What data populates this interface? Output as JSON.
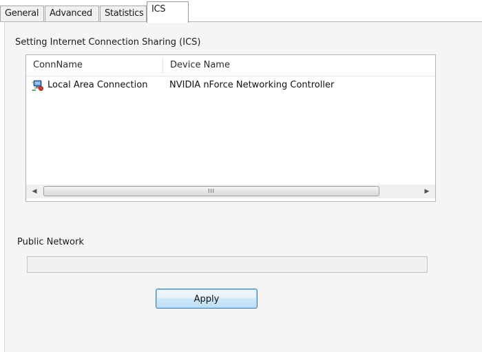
{
  "tabs": [
    {
      "label": "General",
      "active": false
    },
    {
      "label": "Advanced",
      "active": false
    },
    {
      "label": "Statistics",
      "active": false
    },
    {
      "label": "ICS",
      "active": true
    }
  ],
  "ics": {
    "section_title": "Setting Internet Connection Sharing (ICS)",
    "list": {
      "columns": [
        "ConnName",
        "Device Name"
      ],
      "rows": [
        {
          "icon": "network-connection-icon",
          "conn_name": "Local Area Connection",
          "device_name": "NVIDIA nForce Networking Controller"
        }
      ],
      "scrollbar_grip": "III"
    },
    "public_network_label": "Public Network",
    "public_network_value": "",
    "apply_label": "Apply"
  },
  "colors": {
    "button_border": "#3c7fb1",
    "list_border": "#aeb4bb",
    "panel_bg": "#f5f5f5"
  }
}
